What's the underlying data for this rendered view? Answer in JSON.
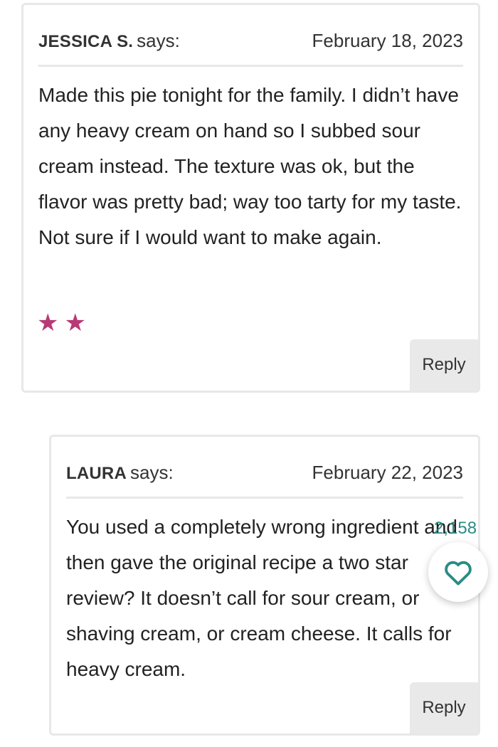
{
  "comments": [
    {
      "author": "JESSICA S.",
      "says": "says:",
      "date": "February 18, 2023",
      "body": "Made this pie tonight for the family. I didn’t have any heavy cream on hand so I subbed sour cream instead. The texture was ok, but the flavor was pretty bad; way too tarty for my taste. Not sure if I would want to make again.",
      "rating": 2,
      "rating_glyphs": "★★",
      "reply_label": "Reply"
    },
    {
      "author": "LAURA",
      "says": "says:",
      "date": "February 22, 2023",
      "body": "You used a completely wrong ingredient and then gave the original recipe a two star review? It doesn’t call for sour cream, or shaving cream, or cream cheese. It calls for heavy cream.",
      "reply_label": "Reply"
    }
  ],
  "like": {
    "count": "2,158",
    "icon": "heart-icon"
  },
  "colors": {
    "star": "#b83a74",
    "like_accent": "#2a8c84",
    "border": "#e8e8e8",
    "reply_bg": "#e9e9e9"
  }
}
